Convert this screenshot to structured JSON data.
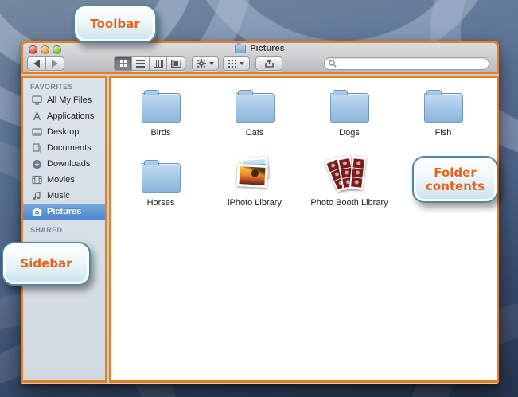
{
  "accent": {
    "outline_orange": "#e8811c",
    "callout_text_orange": "#e2641e",
    "callout_border_teal": "#4f8aa0",
    "selection_blue": "#4a86cc"
  },
  "callouts": {
    "toolbar": "Toolbar",
    "sidebar": "Sidebar",
    "folder_contents": "Folder contents"
  },
  "window": {
    "title": "Pictures"
  },
  "toolbar": {
    "icons": [
      "back-icon",
      "forward-icon",
      "icon-view-icon",
      "list-view-icon",
      "column-view-icon",
      "coverflow-view-icon",
      "gear-icon",
      "arrange-grid-icon",
      "share-icon",
      "search-icon"
    ],
    "selected_view": "icon-view"
  },
  "search": {
    "value": ""
  },
  "sidebar": {
    "headers": {
      "favorites": "FAVORITES",
      "shared": "SHARED"
    },
    "items": [
      {
        "label": "All My Files",
        "icon": "all-my-files-icon",
        "selected": false
      },
      {
        "label": "Applications",
        "icon": "applications-icon",
        "selected": false
      },
      {
        "label": "Desktop",
        "icon": "desktop-icon",
        "selected": false
      },
      {
        "label": "Documents",
        "icon": "documents-icon",
        "selected": false
      },
      {
        "label": "Downloads",
        "icon": "downloads-icon",
        "selected": false
      },
      {
        "label": "Movies",
        "icon": "movies-icon",
        "selected": false
      },
      {
        "label": "Music",
        "icon": "music-icon",
        "selected": false
      },
      {
        "label": "Pictures",
        "icon": "camera-icon",
        "selected": true
      }
    ]
  },
  "content": {
    "items": [
      {
        "label": "Birds",
        "icon": "folder-icon"
      },
      {
        "label": "Cats",
        "icon": "folder-icon"
      },
      {
        "label": "Dogs",
        "icon": "folder-icon"
      },
      {
        "label": "Fish",
        "icon": "folder-icon"
      },
      {
        "label": "Horses",
        "icon": "folder-icon"
      },
      {
        "label": "iPhoto Library",
        "icon": "iphoto-library-icon"
      },
      {
        "label": "Photo Booth Library",
        "icon": "photo-booth-library-icon"
      }
    ]
  }
}
